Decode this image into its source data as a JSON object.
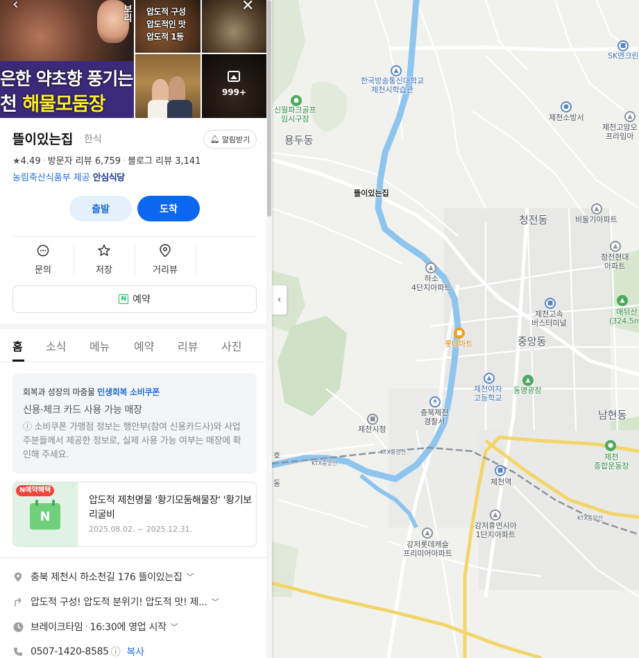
{
  "map": {
    "pin_label": "뜰이있는집",
    "districts": [
      "용두동",
      "청전동",
      "중앙동",
      "남현동"
    ],
    "labels": {
      "univ": "한국방송통신대학교\n제천시학습관",
      "golf": "신월파크골프\n임시구장",
      "sk": "SK엔크린",
      "fire": "제천소방서",
      "school": "제천고암오\n프라임아",
      "apt_pigeon": "비둘기아파트",
      "apt_cheongjeon": "청전현대\n아파트",
      "apt_haso": "하소\n4단지아파트",
      "terminal": "제천고속\n버스터미널",
      "mountain": "애뒤산\n(324.5m)",
      "lotte": "롯데마트",
      "girls_school": "제천여자\n고등학교",
      "plaza": "동명광장",
      "police": "충북제천\n경찰서",
      "cityhall": "제천시청",
      "sports": "제천\n종합운동장",
      "station": "제천역",
      "apt_gangjeo": "강저휴먼시아\n1단지아파트",
      "apt_lotte": "강저롯데캐슬\n프리미어아파트",
      "ktx1": "KTX중앙선",
      "ktx2": "KTX중앙선",
      "ktx3": "KTX중앙선",
      "edge1": "호",
      "edge2": "동"
    }
  },
  "gallery": {
    "main_line1": "은한 약초향 풍기는",
    "main_line2_prefix": "천",
    "main_line2": "해물모둠장",
    "main_side": "보리",
    "thumb_lines": [
      "압도적 구성",
      "압도적인 맛",
      "압도적 1등"
    ],
    "photo_count": "999+"
  },
  "place": {
    "title": "뜰이있는집",
    "category": "한식",
    "alarm_label": "알림받기",
    "rating": "4.49",
    "visitor_reviews": "방문자 리뷰 6,759",
    "blog_reviews": "블로그 리뷰 3,141",
    "cert_link": "농림축산식품부 제공",
    "cert_badge": "안심식당"
  },
  "buttons": {
    "depart": "출발",
    "arrive": "도착",
    "reserve": "예약"
  },
  "actions": [
    {
      "label": "문의",
      "icon": "chat-icon"
    },
    {
      "label": "저장",
      "icon": "star-icon"
    },
    {
      "label": "거리뷰",
      "icon": "location-icon"
    }
  ],
  "tabs": [
    "홈",
    "소식",
    "메뉴",
    "예약",
    "리뷰",
    "사진"
  ],
  "coupon": {
    "title_prefix": "회복과 성장의 마중물",
    "title_highlight": "민생회복 소비쿠폰",
    "subtitle": "신용·체크 카드 사용 가능 매장",
    "note": "ⓘ 소비쿠폰 가맹점 정보는 행안부(참여 신용카드사)와 사업주분들께서 제공한 정보로, 실제 사용 가능 여부는 매장에 확인해 주세요."
  },
  "promo": {
    "badge": "N예약혜택",
    "title": "압도적 제천명물 '황기모둠해물장' '황기보리굴비",
    "date": "2025.08.02. ~ 2025.12.31."
  },
  "info": {
    "address": "충북 제천시 하소천길 176 뜰이있는집",
    "direction": "압도적 구성! 압도적 분위기! 압도적 맛! 제...",
    "break_time_label": "브레이크타임",
    "break_time_value": "16:30에 영업 시작",
    "phone": "0507-1420-8585",
    "copy": "복사"
  },
  "colors": {
    "accent_blue": "#0c67f0",
    "link_blue": "#1f6fd6",
    "pin_red": "#f04438",
    "river": "#8ec5ee",
    "highway": "#f2d56b"
  }
}
